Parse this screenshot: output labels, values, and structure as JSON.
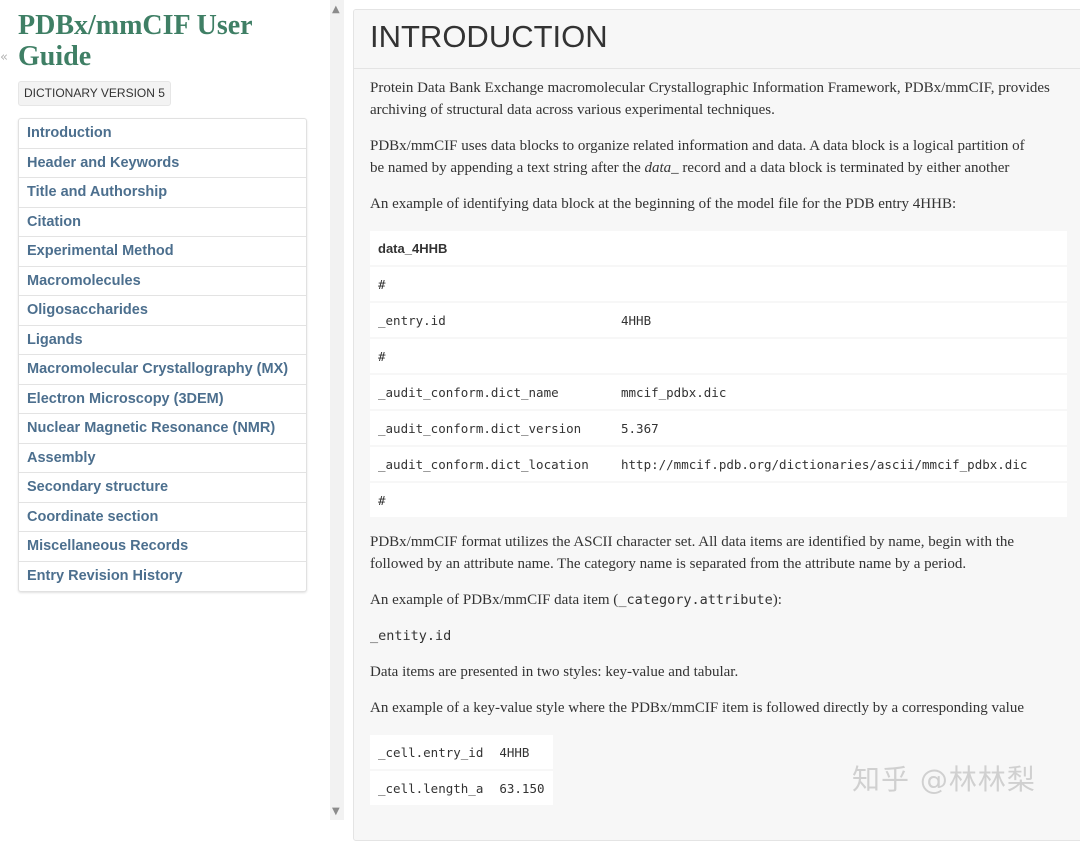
{
  "sidebar": {
    "collapse_icon": "«",
    "title": "PDBx/mmCIF User Guide",
    "version": "DICTIONARY VERSION 5",
    "items": [
      "Introduction",
      "Header and Keywords",
      "Title and Authorship",
      "Citation",
      "Experimental Method",
      "Macromolecules",
      "Oligosaccharides",
      "Ligands",
      "Macromolecular Crystallography (MX)",
      "Electron Microscopy (3DEM)",
      "Nuclear Magnetic Resonance (NMR)",
      "Assembly",
      "Secondary structure",
      "Coordinate section",
      "Miscellaneous Records",
      "Entry Revision History"
    ]
  },
  "scrollbar": {
    "up": "▲",
    "down": "▼"
  },
  "main": {
    "title": "INTRODUCTION",
    "p1_line1": "Protein Data Bank Exchange macromolecular Crystallographic Information Framework, PDBx/mmCIF, provides",
    "p1_line2": "archiving of structural data across various experimental techniques.",
    "p2_line1": "PDBx/mmCIF uses data blocks to organize related information and data. A data block is a logical partition of",
    "p2_line2_a": "be named by appending a text string after the ",
    "p2_line2_em": "data_",
    "p2_line2_b": " record and a data block is terminated by either another",
    "p3": "An example of identifying data block at the beginning of the model file for the PDB entry 4HHB:",
    "block_table": {
      "header": "data_4HHB",
      "rows": [
        [
          "#",
          ""
        ],
        [
          "_entry.id",
          "4HHB"
        ],
        [
          "#",
          ""
        ],
        [
          "_audit_conform.dict_name",
          "mmcif_pdbx.dic"
        ],
        [
          "_audit_conform.dict_version",
          "5.367"
        ],
        [
          "_audit_conform.dict_location",
          "http://mmcif.pdb.org/dictionaries/ascii/mmcif_pdbx.dic"
        ],
        [
          "#",
          ""
        ]
      ]
    },
    "p4_line1": "PDBx/mmCIF format utilizes the ASCII character set. All data items are identified by name, begin with the",
    "p4_line2": "followed by an attribute name. The category name is separated from the attribute name by a period.",
    "p5_a": "An example of PDBx/mmCIF data item (",
    "p5_code": "_category.attribute",
    "p5_b": "):",
    "code_example": "_entity.id",
    "p6": "Data items are presented in two styles: key-value and tabular.",
    "p7": "An example of a key-value style where the PDBx/mmCIF item is followed directly by a corresponding value",
    "kv_table": [
      [
        "_cell.entry_id",
        "4HHB"
      ],
      [
        "_cell.length_a",
        "63.150"
      ]
    ]
  },
  "watermark": "知乎 @林林梨"
}
